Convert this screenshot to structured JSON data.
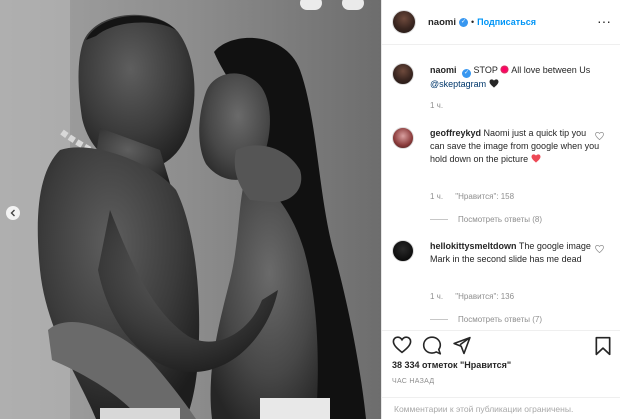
{
  "header": {
    "username": "naomi",
    "follow_label": "Подписаться",
    "separator": "•",
    "more_label": "···"
  },
  "caption": {
    "username": "naomi",
    "text_start": "STOP",
    "text_end": "All love between Us",
    "mention": "@skeptagram",
    "time": "1 ч."
  },
  "comments": [
    {
      "username": "geoffreykyd",
      "text": "Naomi just a quick tip you can save the image from google when you hold down on the picture",
      "time": "1 ч.",
      "likes": "\"Нравится\": 158",
      "replies": "Посмотреть ответы (8)"
    },
    {
      "username": "hellokittysmeltdown",
      "text": "The google image Mark in the second slide has me dead",
      "time": "1 ч.",
      "likes": "\"Нравится\": 136",
      "replies": "Посмотреть ответы (7)"
    }
  ],
  "post": {
    "likes": "38 334 отметок \"Нравится\"",
    "timestamp": "ЧАС НАЗАД",
    "comments_closed": "Комментарии к этой публикации ограничены."
  },
  "colors": {
    "accent": "#0095f6",
    "mention": "#00376b",
    "heart_red": "#ed4956",
    "stop_red": "#e0245e"
  },
  "icons": [
    "heart-icon",
    "comment-icon",
    "share-icon",
    "bookmark-icon",
    "verified-icon",
    "more-icon",
    "chevron-left-icon"
  ]
}
